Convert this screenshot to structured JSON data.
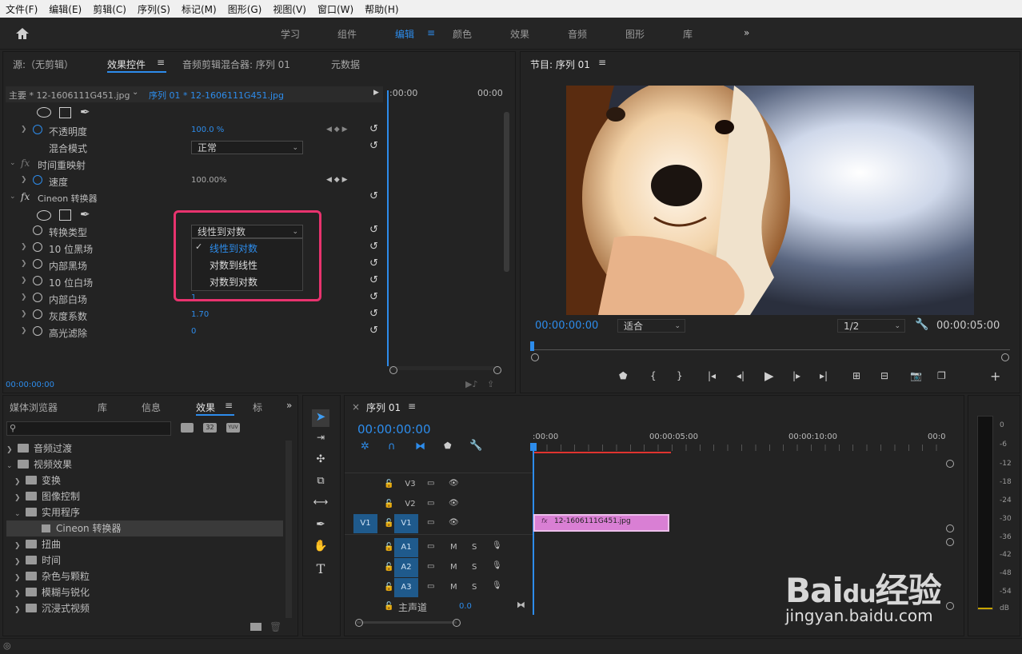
{
  "menu": [
    "文件(F)",
    "编辑(E)",
    "剪辑(C)",
    "序列(S)",
    "标记(M)",
    "图形(G)",
    "视图(V)",
    "窗口(W)",
    "帮助(H)"
  ],
  "workspace": {
    "tabs": [
      "学习",
      "组件",
      "编辑",
      "颜色",
      "效果",
      "音频",
      "图形",
      "库"
    ],
    "active": "编辑"
  },
  "effect_panel": {
    "tabs": [
      "源:（无剪辑）",
      "效果控件",
      "音频剪辑混合器: 序列 01",
      "元数据"
    ],
    "master_clip": "主要 * 12-1606111G451.jpg",
    "seq_clip": "序列 01 * 12-1606111G451.jpg",
    "time_left": ":00:00",
    "time_right": "00:00",
    "opacity_label": "不透明度",
    "opacity_value": "100.0 %",
    "blend_label": "混合模式",
    "blend_value": "正常",
    "time_remap": "时间重映射",
    "speed_label": "速度",
    "speed_value": "100.00%",
    "cineon": "Cineon 转换器",
    "conv_type_label": "转换类型",
    "conv_type_value": "线性到对数",
    "dropdown_options": [
      "线性到对数",
      "对数到线性",
      "对数到对数"
    ],
    "p1": "10 位黑场",
    "p2": "内部黑场",
    "p3": "10 位白场",
    "p4": "内部白场",
    "p4_val": "1",
    "p5": "灰度系数",
    "p5_val": "1.70",
    "p6": "高光滤除",
    "p6_val": "0",
    "timecode": "00:00:00:00"
  },
  "program": {
    "title": "节目: 序列 01",
    "timecode": "00:00:00:00",
    "fit": "适合",
    "res": "1/2",
    "duration": "00:00:05:00"
  },
  "browser": {
    "tabs": [
      "媒体浏览器",
      "库",
      "信息",
      "效果",
      "标"
    ],
    "items": [
      {
        "label": "音频过渡",
        "level": 0,
        "open": false
      },
      {
        "label": "视频效果",
        "level": 0,
        "open": true
      },
      {
        "label": "变换",
        "level": 1,
        "open": false
      },
      {
        "label": "图像控制",
        "level": 1,
        "open": false
      },
      {
        "label": "实用程序",
        "level": 1,
        "open": true
      },
      {
        "label": "Cineon 转换器",
        "level": 2,
        "open": false
      },
      {
        "label": "扭曲",
        "level": 1,
        "open": false
      },
      {
        "label": "时间",
        "level": 1,
        "open": false
      },
      {
        "label": "杂色与颗粒",
        "level": 1,
        "open": false
      },
      {
        "label": "模糊与锐化",
        "level": 1,
        "open": false
      },
      {
        "label": "沉浸式视频",
        "level": 1,
        "open": false
      }
    ]
  },
  "timeline": {
    "title": "序列 01",
    "timecode": "00:00:00:00",
    "ruler": [
      ":00:00",
      "00:00:05:00",
      "00:00:10:00",
      "00:0"
    ],
    "tracks": {
      "v3": "V3",
      "v2": "V2",
      "v1": "V1",
      "a1": "A1",
      "a2": "A2",
      "a3": "A3",
      "src_v1": "V1"
    },
    "master": "主声道",
    "master_val": "0.0",
    "clip": "12-1606111G451.jpg",
    "m": "M",
    "s": "S"
  },
  "meter": {
    "labels": [
      "0",
      "-6",
      "-12",
      "-18",
      "-24",
      "-30",
      "-36",
      "-42",
      "-48",
      "-54",
      "dB"
    ]
  },
  "watermark": {
    "text": "jingyan.baidu.com"
  },
  "colors": {
    "accent": "#2d8ceb",
    "highlight": "#e8336e",
    "clip": "#d97fd4"
  }
}
